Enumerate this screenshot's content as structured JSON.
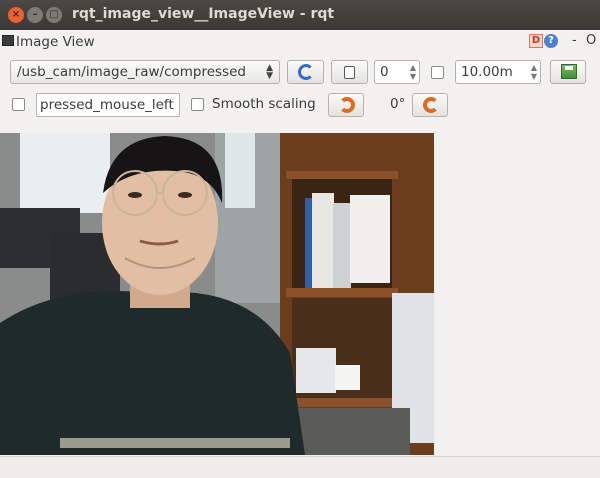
{
  "window": {
    "title": "rqt_image_view__ImageView - rqt",
    "close": "×",
    "minimize": "–",
    "maximize": "□"
  },
  "plugin": {
    "title": "Image View",
    "header_buttons": {
      "d": "D",
      "help": "?",
      "minimize": "-",
      "close": "O"
    }
  },
  "toolbar": {
    "topic": "/usb_cam/image_raw/compressed",
    "max_depth": "0",
    "rate": "10.00m",
    "rate_checked": false,
    "mouse_topic": "pressed_mouse_left",
    "mouse_checked": false,
    "smooth_scaling_label": "Smooth scaling",
    "smooth_scaling_checked": false,
    "rotation": "0°"
  },
  "icons": {
    "refresh": "refresh-icon",
    "bag": "bag-icon",
    "save": "save-image-icon",
    "rotate_left": "rotate-left-icon",
    "rotate_right": "rotate-right-icon"
  },
  "colors": {
    "refresh_blue": "#2f6fcb",
    "rotate_orange": "#e06a1f",
    "titlebar": "#3a3935"
  }
}
